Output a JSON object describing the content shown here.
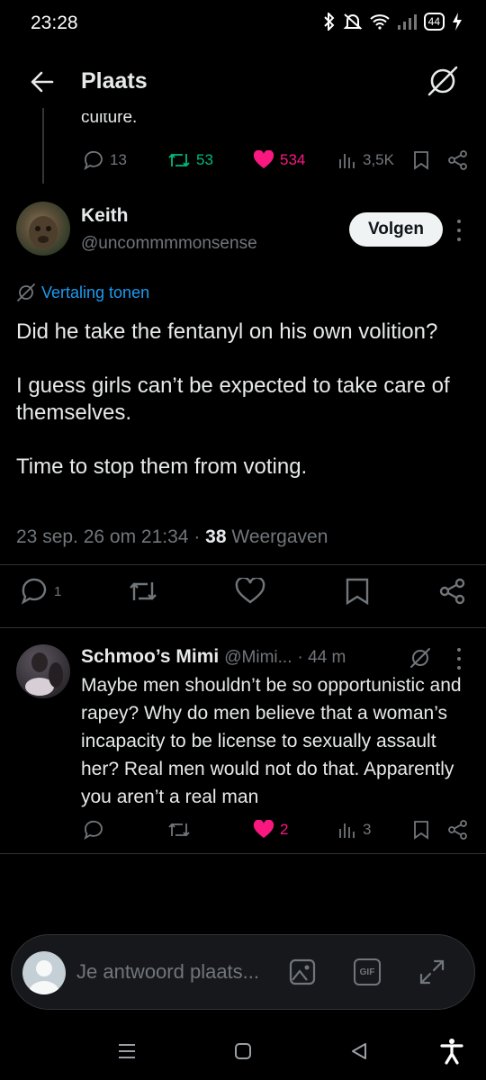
{
  "status_bar": {
    "time": "23:28",
    "battery": "44",
    "icons": [
      "bluetooth-icon",
      "mute-icon",
      "wifi-icon",
      "signal-icon",
      "charging-icon"
    ]
  },
  "header": {
    "title": "Plaats",
    "icons": [
      "back-arrow-icon",
      "translate-icon"
    ]
  },
  "previous_tweet": {
    "clipped_text": "culture.",
    "replies": "13",
    "retweets": "53",
    "likes": "534",
    "views": "3,5K"
  },
  "main_tweet": {
    "name": "Keith",
    "handle": "@uncommmmonsense",
    "follow_label": "Volgen",
    "translate_label": "Vertaling tonen",
    "paragraphs": [
      "Did he take the fentanyl on his own volition?",
      "I guess girls can’t be expected to take care of themselves.",
      "Time to stop them from voting."
    ],
    "timestamp": "23 sep. 26 om 21:34",
    "separator": "·",
    "views_count": "38",
    "views_label": "Weergaven",
    "replies": "1"
  },
  "reply": {
    "name": "Schmoo’s Mimi",
    "handle": "@Mimi...",
    "time": "· 44 m",
    "text": "Maybe men shouldn’t be so opportunistic and rapey? Why do men believe that a woman’s incapacity to be license to sexually assault her? Real men would not do that. Apparently you aren’t a real man",
    "likes": "2",
    "views": "3"
  },
  "composer": {
    "placeholder": "Je antwoord plaats...",
    "gif_label": "GIF"
  },
  "colors": {
    "background": "#000000",
    "text": "#e7e9ea",
    "muted": "#71767b",
    "link": "#1d9bf0",
    "like": "#f91880",
    "retweet": "#00ba7c"
  }
}
